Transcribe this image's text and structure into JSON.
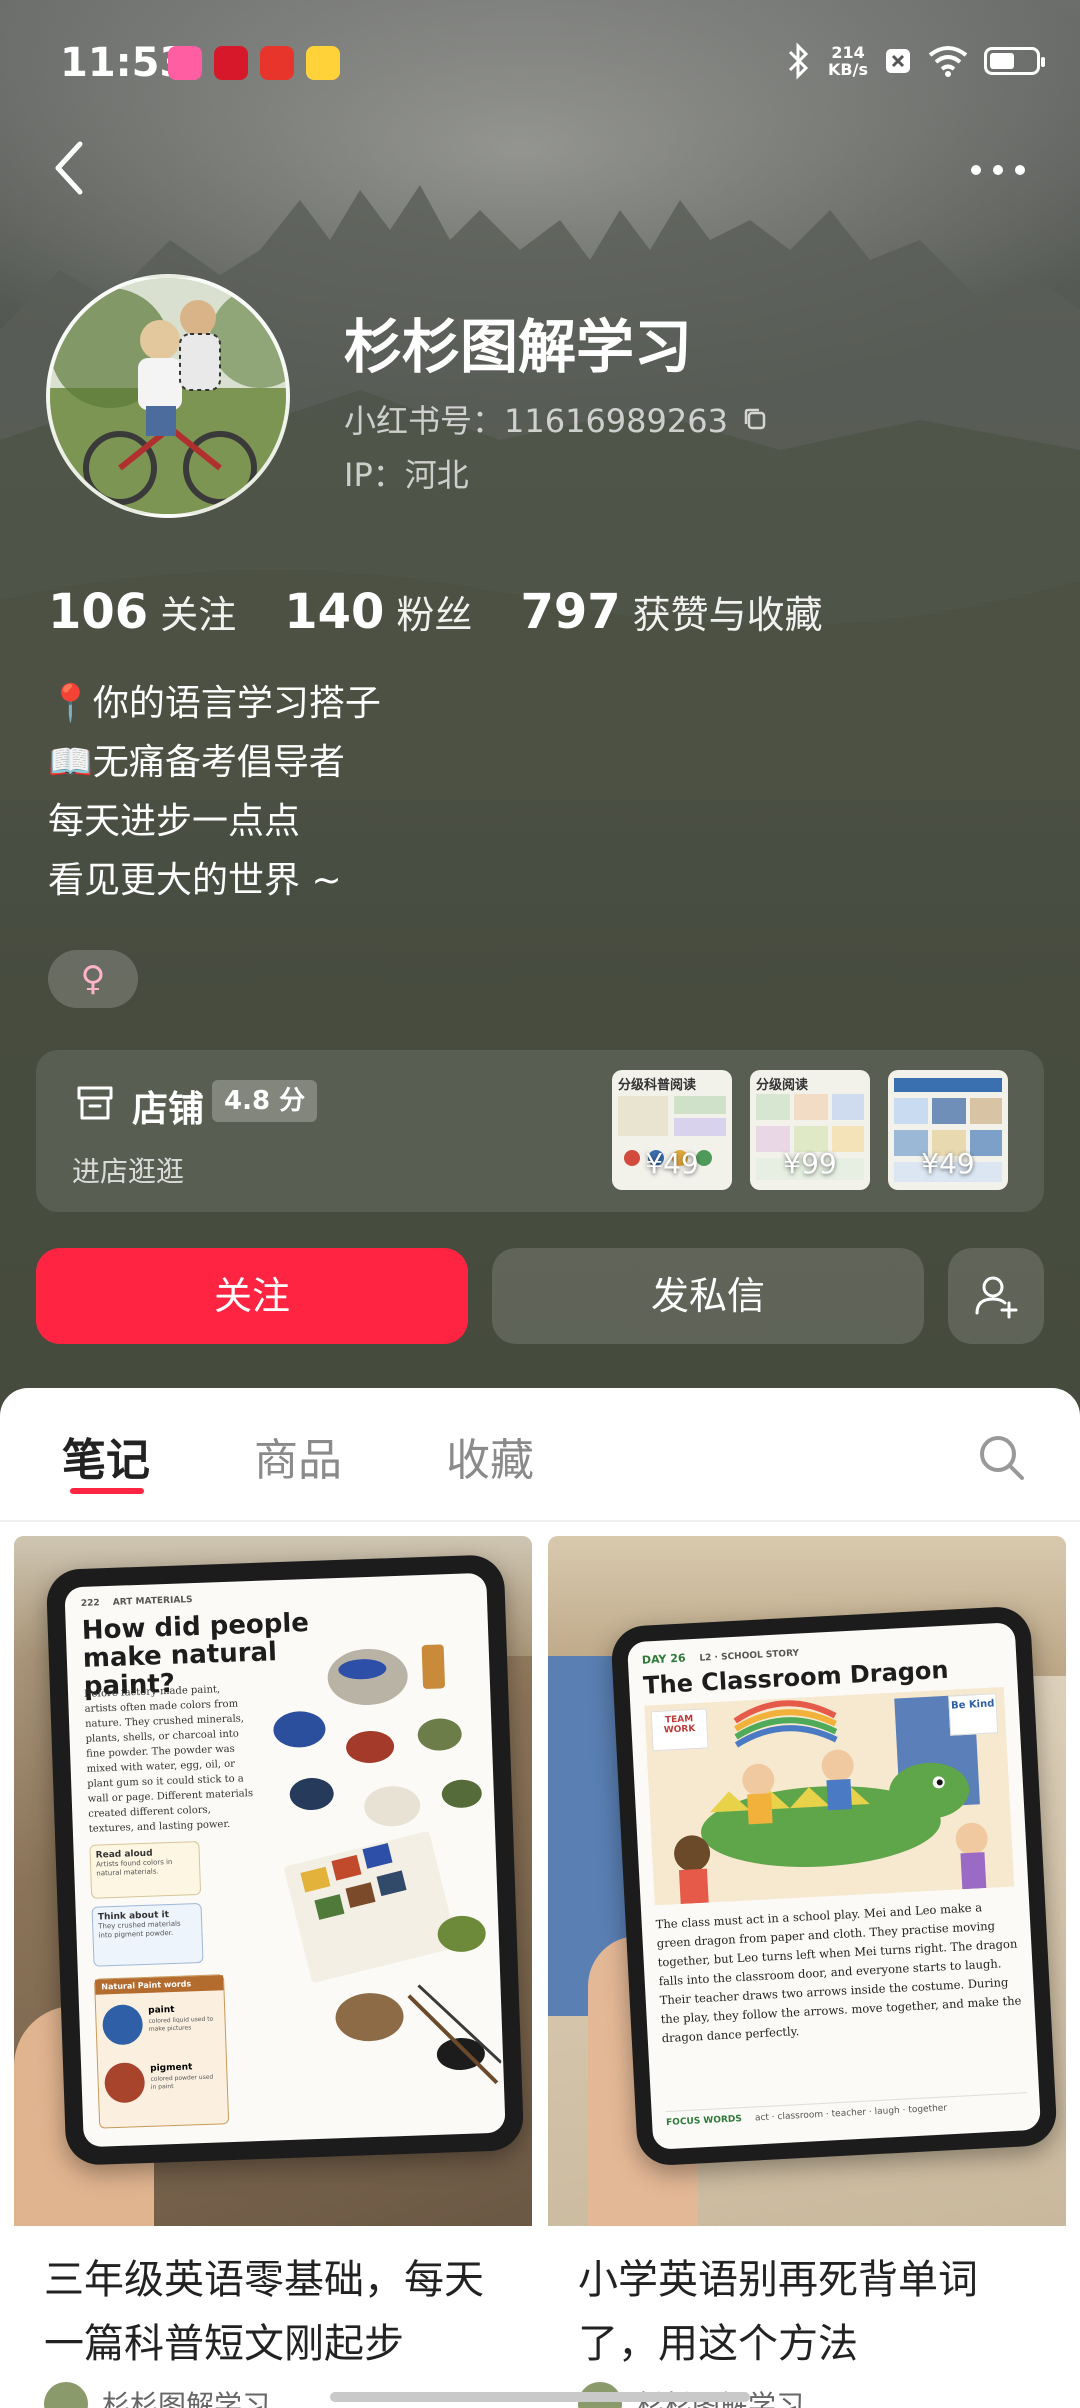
{
  "status_bar": {
    "time": "11:53",
    "net_speed_value": "214",
    "net_speed_unit": "KB/s",
    "battery_level": 0.6
  },
  "profile": {
    "name": "杉杉图解学习",
    "id_label": "小红书号：11616989263",
    "ip_label": "IP：河北",
    "stats": [
      {
        "num": "106",
        "label": "关注"
      },
      {
        "num": "140",
        "label": "粉丝"
      },
      {
        "num": "797",
        "label": "获赞与收藏"
      }
    ],
    "bio": [
      "📍你的语言学习搭子",
      "📖无痛备考倡导者",
      "每天进步一点点",
      "看见更大的世界 ~"
    ],
    "gender_symbol": "♀"
  },
  "shop": {
    "title": "店铺",
    "rating": "4.8 分",
    "subtitle": "进店逛逛",
    "products": [
      {
        "title": "分级科普阅读",
        "price": "¥49"
      },
      {
        "title": "分级阅读",
        "price": "¥99"
      },
      {
        "title": "",
        "price": "¥49"
      }
    ]
  },
  "actions": {
    "follow": "关注",
    "message": "发私信"
  },
  "tabs": [
    {
      "label": "笔记",
      "active": true
    },
    {
      "label": "商品",
      "active": false
    },
    {
      "label": "收藏",
      "active": false
    }
  ],
  "notes": [
    {
      "title": "三年级英语零基础，每天一篇科普短文刚起步",
      "author": "杉杉图解学习",
      "tablet_page": "222",
      "tablet_section": "ART MATERIALS",
      "tablet_heading": "How did people make natural paint?",
      "tablet_body": "Before factory-made paint, artists often made colors from nature. They crushed minerals, plants, shells, or charcoal into fine powder. The powder was mixed with water, egg, oil, or plant gum so it could stick to a wall or page. Different materials created different colors, textures, and lasting power.",
      "tablet_box1": "Read aloud",
      "tablet_box1_text": "Artists found colors in natural materials.",
      "tablet_box2": "Think about it",
      "tablet_box2_text": "They crushed materials into pigment powder.",
      "tablet_words_title": "Natural Paint words",
      "tablet_word1": "paint",
      "tablet_word1_text": "colored liquid used to make pictures",
      "tablet_word2": "pigment",
      "tablet_word2_text": "colored powder used in paint"
    },
    {
      "title": "小学英语别再死背单词了，用这个方法",
      "author": "杉杉图解学习",
      "tablet_day": "DAY 26",
      "tablet_tag": "L2 · SCHOOL STORY",
      "tablet_heading": "The Classroom Dragon",
      "tablet_poster1": "TEAM WORK",
      "tablet_poster2": "Be Kind",
      "tablet_body": "The class must act in a school play. Mei and Leo make a green dragon from paper and cloth. They practise moving together, but Leo turns left when Mei turns right. The dragon falls into the classroom door, and everyone starts to laugh. Their teacher draws two arrows inside the costume. During the play, they follow the arrows. move together, and make the dragon dance perfectly.",
      "tablet_focus": "FOCUS WORDS",
      "tablet_focus_words": "act · classroom · teacher · laugh · together"
    }
  ],
  "colors": {
    "accent": "#ff2442",
    "header_bg": "#4a4f44"
  },
  "icons": [
    "back-arrow-icon",
    "more-dots-icon",
    "copy-icon",
    "store-icon",
    "add-friend-icon",
    "search-icon",
    "bluetooth-icon",
    "wifi-icon",
    "battery-icon"
  ]
}
